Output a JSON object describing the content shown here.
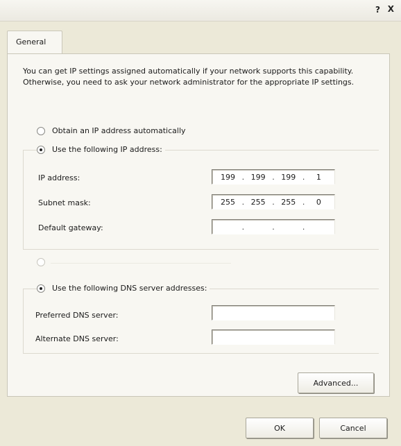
{
  "window": {
    "title": "",
    "help_label": "?",
    "close_label": "X"
  },
  "tabs": [
    {
      "label": "General"
    }
  ],
  "general": {
    "intro_text": "You can get IP settings assigned automatically if your network supports this capability. Otherwise, you need to ask your network administrator for the appropriate IP settings.",
    "ip_mode": {
      "auto_label": "Obtain an IP address automatically",
      "auto_selected": false,
      "manual_label": "Use the following IP address:",
      "manual_selected": true
    },
    "ip_fields": [
      {
        "label": "IP address:",
        "octets": [
          "199",
          "199",
          "199",
          "1"
        ]
      },
      {
        "label": "Subnet mask:",
        "octets": [
          "255",
          "255",
          "255",
          "0"
        ]
      },
      {
        "label": "Default gateway:",
        "octets": [
          "",
          "",
          "",
          ""
        ]
      }
    ],
    "dns_mode": {
      "auto_label": "",
      "auto_selected": false,
      "manual_label": "Use the following DNS server addresses:",
      "manual_selected": true
    },
    "dns_fields": [
      {
        "label": "Preferred DNS server:",
        "octets": [
          "",
          "",
          "",
          ""
        ]
      },
      {
        "label": "Alternate DNS server:",
        "octets": [
          "",
          "",
          "",
          ""
        ]
      }
    ],
    "advanced_label": "Advanced..."
  },
  "footer": {
    "ok_label": "OK",
    "cancel_label": "Cancel"
  }
}
